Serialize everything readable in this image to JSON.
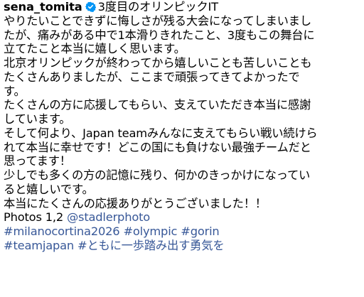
{
  "post": {
    "username": "sena_tomita",
    "verified_icon": "verified-badge-icon",
    "title": "3度目のオリンピックIT",
    "caption_lines": [
      "やりたいことできずに悔しさが残る大会になってしまいまし",
      "たが、痛みがある中で1本滑りきれたこと、3度もこの舞台に",
      "立てたこと本当に嬉しく思います。",
      "北京オリンピックが終わってから嬉しいことも苦しいことも",
      "たくさんありましたが、ここまで頑張ってきてよかったで",
      "す。",
      "たくさんの方に応援してもらい、支えていただき本当に感謝",
      "しています。",
      "そして何より、Japan teamみんなに支えてもらい戦い続けら",
      "れて本当に幸せです！どこの国にも負けない最強チームだと",
      "思ってます！",
      "少しでも多くの方の記憶に残り、何かのきっかけになってい",
      "ると嬉しいです。",
      "本当にたくさんの応援ありがとうございました！！"
    ],
    "photos_credit": {
      "prefix": "Photos 1,2 ",
      "mention": "@stadlerphoto"
    },
    "hashtags": {
      "line1": [
        {
          "text": "#milanocortina2026"
        },
        {
          "text": "#olympic"
        },
        {
          "text": "#gorin"
        }
      ],
      "line2": [
        {
          "text": "#teamjapan"
        },
        {
          "text": "#ともに一歩踏み出す勇気を"
        }
      ]
    }
  },
  "colors": {
    "text": "#000000",
    "link": "#385898",
    "verified_badge": "#0095f6"
  }
}
